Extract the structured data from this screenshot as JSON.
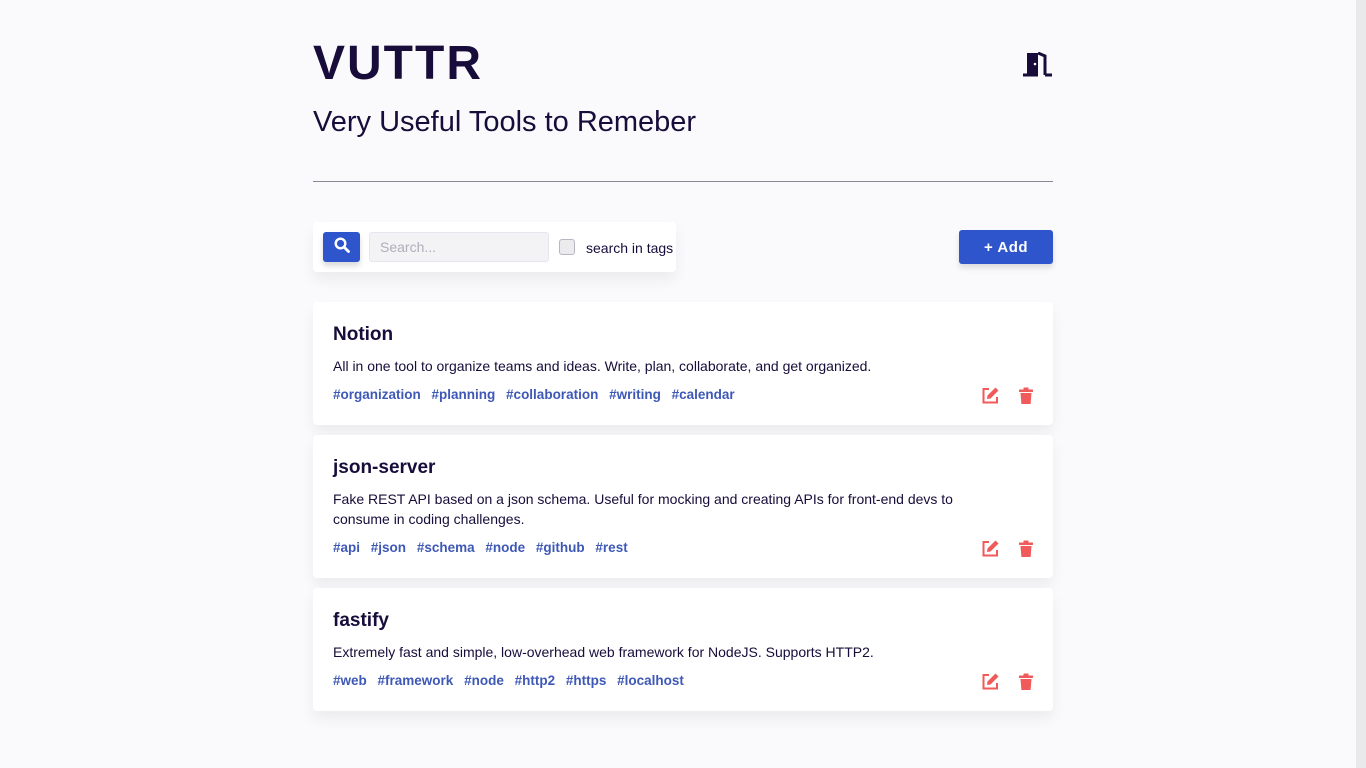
{
  "app": {
    "logo": "VUTTR",
    "subtitle": "Very Useful Tools to Remeber"
  },
  "toolbar": {
    "search_placeholder": "Search...",
    "search_value": "",
    "search_in_tags_label": "search in tags",
    "search_in_tags_checked": false,
    "add_label": "+ Add"
  },
  "colors": {
    "primary": "#2f55cc",
    "text": "#170c3a",
    "tag": "#3e58b6",
    "danger": "#f05a5a"
  },
  "tools": [
    {
      "title": "Notion",
      "description": "All in one tool to organize teams and ideas. Write, plan, collaborate, and get organized.",
      "tags": [
        "#organization",
        "#planning",
        "#collaboration",
        "#writing",
        "#calendar"
      ]
    },
    {
      "title": "json-server",
      "description": "Fake REST API based on a json schema. Useful for mocking and creating APIs for front-end devs to consume in coding challenges.",
      "tags": [
        "#api",
        "#json",
        "#schema",
        "#node",
        "#github",
        "#rest"
      ]
    },
    {
      "title": "fastify",
      "description": "Extremely fast and simple, low-overhead web framework for NodeJS. Supports HTTP2.",
      "tags": [
        "#web",
        "#framework",
        "#node",
        "#http2",
        "#https",
        "#localhost"
      ]
    }
  ],
  "icons": {
    "logout": "door-exit-icon",
    "search": "search-icon",
    "edit": "edit-icon",
    "delete": "trash-icon"
  }
}
